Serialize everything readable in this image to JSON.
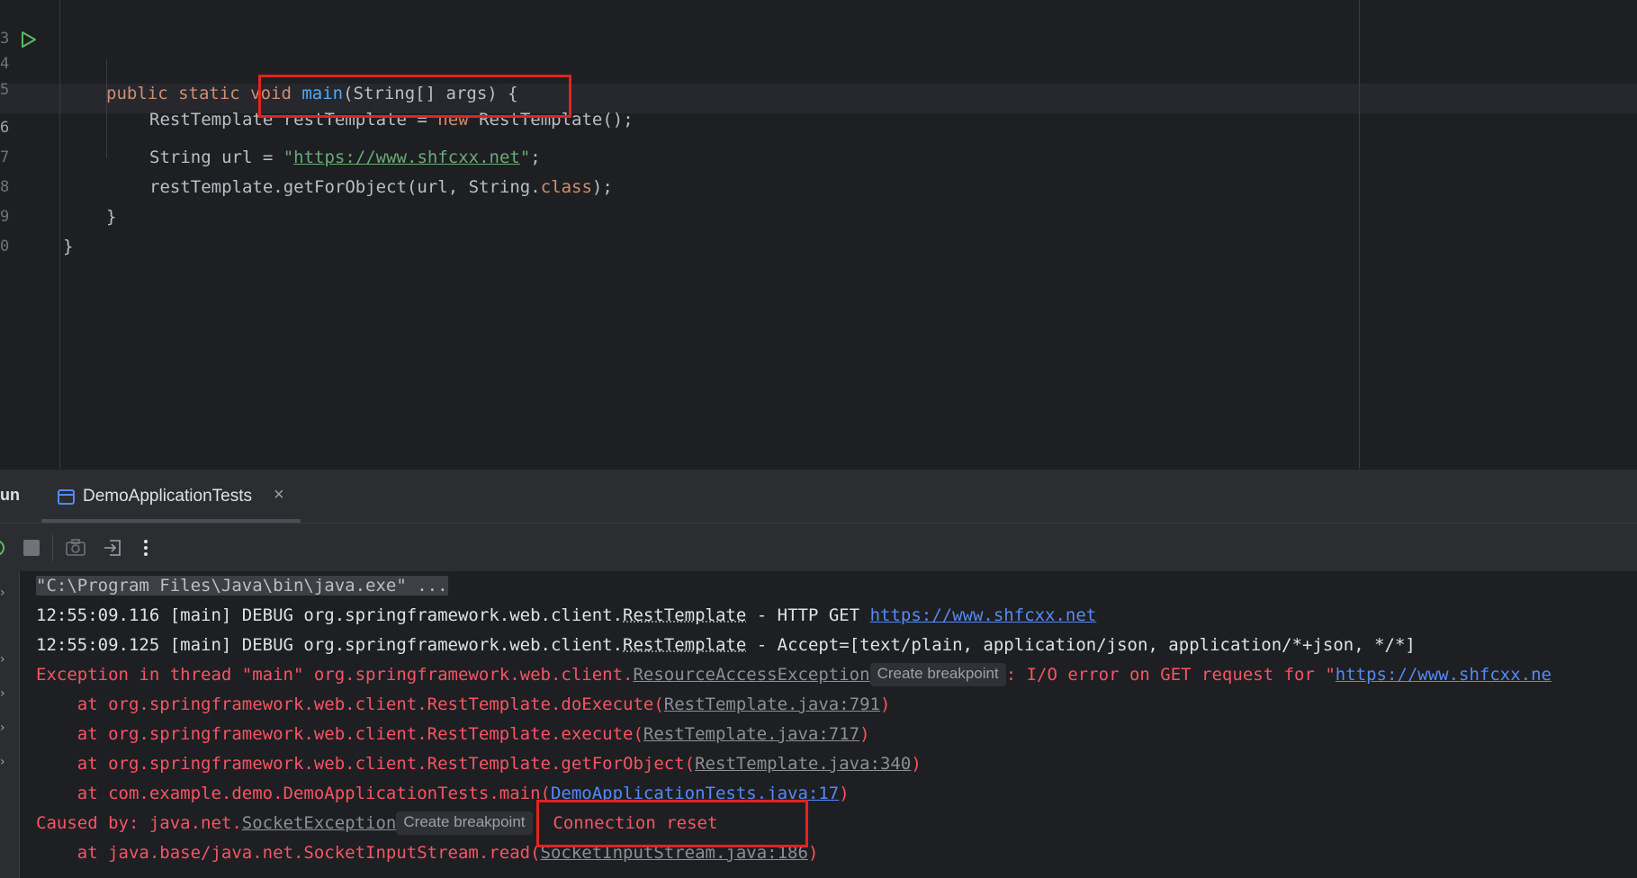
{
  "editor": {
    "lines": [
      {
        "number": "3"
      },
      {
        "number": "4",
        "tokens": {
          "kw1": "public static void ",
          "fn": "main",
          "rest": "(String[] args) {"
        }
      },
      {
        "number": "5",
        "tokens": {
          "a": "RestTemplate restTemplate = ",
          "kw": "new",
          "b": " RestTemplate();"
        }
      },
      {
        "number": "6",
        "tokens": {
          "a": "String url = ",
          "q1": "\"",
          "link": "https://www.shfcxx.net",
          "q2": "\"",
          "b": ";"
        }
      },
      {
        "number": "7",
        "tokens": {
          "a": "restTemplate.getForObject(url, String.",
          "kw": "class",
          "b": ");"
        }
      },
      {
        "number": "8",
        "tokens": {
          "a": "}"
        }
      },
      {
        "number": "9",
        "tokens": {
          "a": "}"
        }
      },
      {
        "number": "0"
      }
    ]
  },
  "run_panel": {
    "title": "un",
    "tab_label": "DemoApplicationTests",
    "close_glyph": "×"
  },
  "console": {
    "command": "\"C:\\Program Files\\Java\\bin\\java.exe\" ...",
    "debug1": {
      "prefix": "12:55:09.116 [main] DEBUG org.springframework.web.client.",
      "cls": "RestTemplate",
      "mid": " - HTTP GET ",
      "url": "https://www.shfcxx.net"
    },
    "debug2": {
      "prefix": "12:55:09.125 [main] DEBUG org.springframework.web.client.",
      "cls": "RestTemplate",
      "rest": " - Accept=[text/plain, application/json, application/*+json, */*]"
    },
    "exception": {
      "prefix": "Exception in thread \"main\" org.springframework.web.client.",
      "cls": "ResourceAccessException",
      "bp": "Create breakpoint",
      "msg": ": I/O error on GET request for \"",
      "url": "https://www.shfcxx.ne"
    },
    "stack": [
      {
        "text": "    at org.springframework.web.client.RestTemplate.doExecute(",
        "loc": "RestTemplate.java:791",
        "end": ")"
      },
      {
        "text": "    at org.springframework.web.client.RestTemplate.execute(",
        "loc": "RestTemplate.java:717",
        "end": ")"
      },
      {
        "text": "    at org.springframework.web.client.RestTemplate.getForObject(",
        "loc": "RestTemplate.java:340",
        "end": ")"
      },
      {
        "text": "    at com.example.demo.DemoApplicationTests.main(",
        "loc": "DemoApplicationTests.java:17",
        "end": ")"
      }
    ],
    "caused": {
      "prefix": "Caused by: java.net.",
      "cls": "SocketException",
      "bp": "Create breakpoint",
      "msg": ": Connection reset"
    },
    "stack2": {
      "text": "    at java.base/java.net.SocketInputStream.read(",
      "loc": "SocketInputStream.java:186",
      "end": ")"
    }
  },
  "colors": {
    "background": "#1e1f22",
    "keyword": "#cf8e6d",
    "function": "#56a8f5",
    "string": "#6aab73",
    "error": "#f75464",
    "link": "#548af7",
    "annotation_box": "#e5221e"
  }
}
